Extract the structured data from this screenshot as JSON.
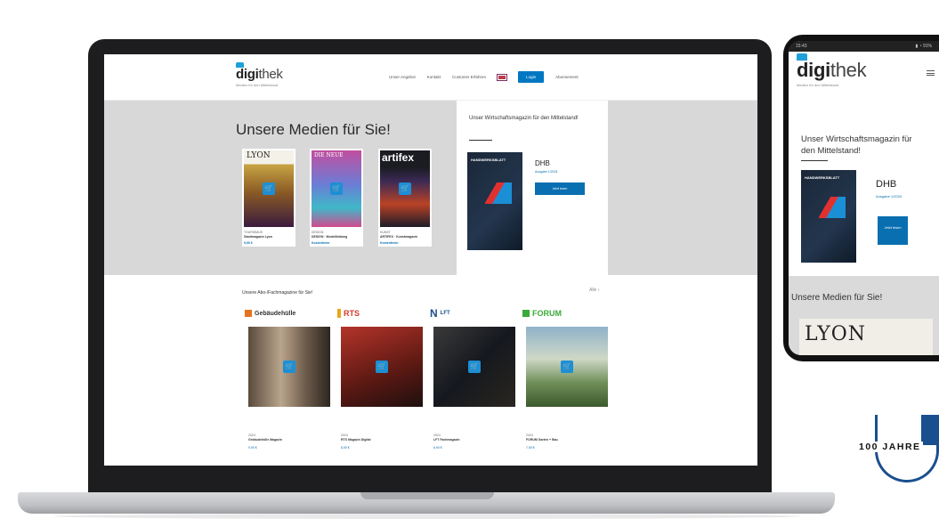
{
  "desktop": {
    "logo": {
      "bold": "digi",
      "thin": "thek",
      "sub": "Medien für den Mittelstand"
    },
    "nav": [
      "Unser Angebot",
      "Kontakt",
      "Customer Erfahren",
      "Login",
      "Abonnement"
    ],
    "hero": {
      "title": "Unsere Medien für Sie!",
      "cards": [
        {
          "cover_title": "LYON",
          "meta_top": "TOURISMUS",
          "meta_name": "Stadtmagazin Lyon",
          "price": "9,90 €"
        },
        {
          "cover_title": "DIE NEUE",
          "meta_top": "DESIGN",
          "meta_name": "DESIGN · Modellbildung",
          "price": "Kostenfreier"
        },
        {
          "cover_title": "artifex",
          "meta_top": "KUNST",
          "meta_name": "ARTIFEX · Kunstmagazin",
          "price": "Kostenfreier"
        }
      ]
    },
    "promo": {
      "title": "Unser Wirtschaftsmagazin für den Mittelstand!",
      "cover_text": "HANDWERKSBLATT",
      "name": "DHB",
      "sub": "Ausgabe 1/2024",
      "button": "Jetzt lesen"
    },
    "abo": {
      "title": "Unsere Abo-/Fachmagazine für Sie!",
      "all_link": "Alle ›",
      "cards": [
        {
          "brand": "Gebäudehülle",
          "meta": "2024",
          "name": "Gebäudehülle Magazin",
          "price": "9,90 €"
        },
        {
          "brand": "RTS",
          "meta": "2024",
          "name": "RTS Magazin Digital",
          "price": "8,90 €"
        },
        {
          "brand": "LFT",
          "meta": "2024",
          "name": "LFT Fachmagazin",
          "price": "6,90 €"
        },
        {
          "brand": "FORUM",
          "meta": "2024",
          "name": "FORUM Garten + Bau",
          "price": "7,90 €"
        }
      ]
    }
  },
  "phone": {
    "status_left": "15:43",
    "status_right": "▮ ◔ 91%",
    "logo": {
      "bold": "digi",
      "thin": "thek",
      "sub": "Medien für den Mittelstand"
    },
    "promo": {
      "title": "Unser Wirtschaftsmagazin für den Mittelstand!",
      "name": "DHB",
      "sub": "Ausgabe 1/2024",
      "button": "Jetzt lesen"
    },
    "hero_title": "Unsere Medien für Sie!",
    "lyon": "LYON"
  },
  "jahre": {
    "text": "100 JAHRE"
  },
  "colors": {
    "brand_blue": "#0a6fb0",
    "logo_blue": "#1fa0d8",
    "hero_gray": "#d8d8d8"
  }
}
